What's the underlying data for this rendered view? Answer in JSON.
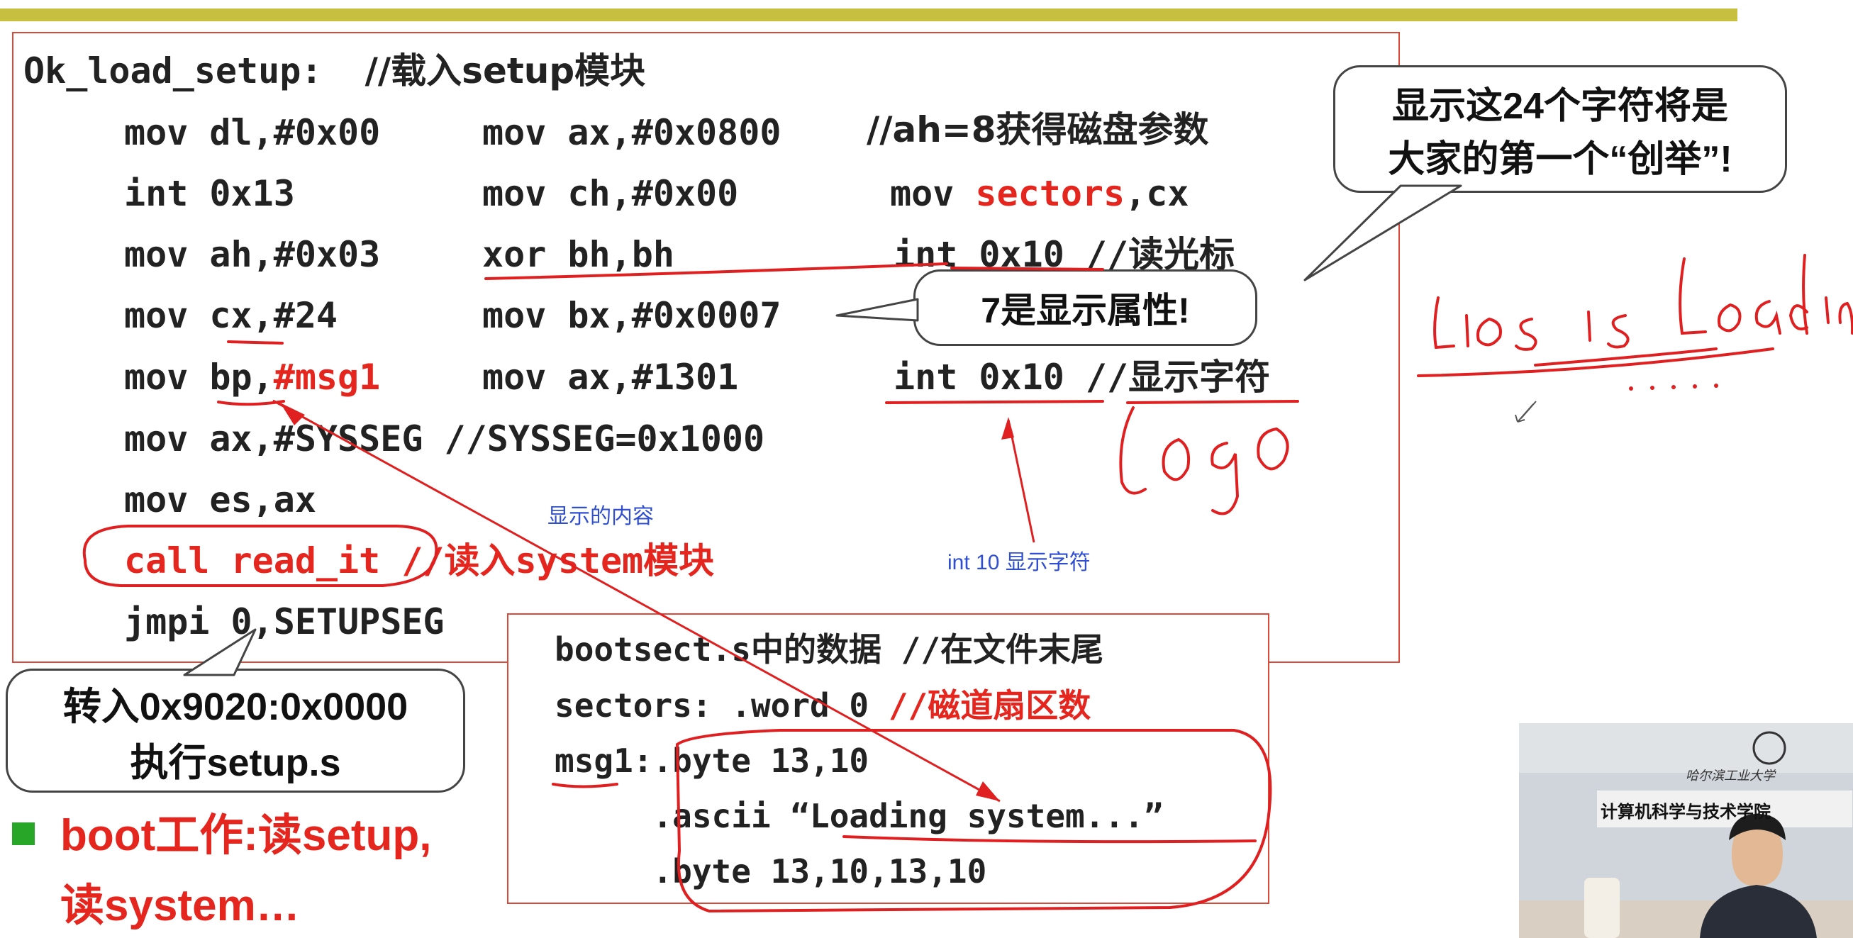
{
  "code": {
    "title_label": "Ok_load_setup:",
    "title_comment": "//载入setup模块",
    "l1a": "mov dl,#0x00",
    "l1b": "mov ax,#0x0800",
    "l1c": "//ah=8获得磁盘参数",
    "l2a": "int 0x13",
    "l2b": "mov ch,#0x00",
    "l2c1": "mov ",
    "l2c2": "sectors",
    "l2c3": ",cx",
    "l3a": "mov ah,#0x03",
    "l3b": "xor bh,bh",
    "l3c": "int 0x10 //读光标",
    "l4a": "mov cx,#24",
    "l4b": "mov bx,#0x0007",
    "l5a1": "mov bp,",
    "l5a2": "#msg1",
    "l5b": "mov ax,#1301",
    "l5c": "int 0x10 //显示字符",
    "l6": "mov ax,#SYSSEG //SYSSEG=0x1000",
    "l7": "mov es,ax",
    "l8": "call read_it //读入system模块",
    "l9": "jmpi 0,SETUPSEG"
  },
  "bubbles": {
    "b1_line1": "显示这24个字符将是",
    "b1_line2": "大家的第一个“创举”!",
    "b2": "7是显示属性!",
    "b3_line1": "转入0x9020:0x0000",
    "b3_line2": "执行setup.s"
  },
  "data_box": {
    "d1": "bootsect.s中的数据 //在文件末尾",
    "d2a": "sectors: .word 0 ",
    "d2b": "//磁道扇区数",
    "d3": "msg1:.byte 13,10",
    "d4": "     .ascii “Loading system...”",
    "d5": "     .byte 13,10,13,10"
  },
  "annotations": {
    "a1": "显示的内容",
    "a2": "int 10 显示字符"
  },
  "bullet": {
    "line1": "boot工作:读setup,",
    "line2": "读system…"
  },
  "video": {
    "sign_line1": "哈尔滨工业大学",
    "sign_line2": "计算机科学与技术学院"
  },
  "colors": {
    "accent_red": "#e5261f",
    "ink_red": "#e02020",
    "heading_blue": "#2436a8",
    "annotation_blue": "#2f4fd0",
    "top_bar": "#c7bf3f",
    "bullet_green": "#27a627"
  }
}
